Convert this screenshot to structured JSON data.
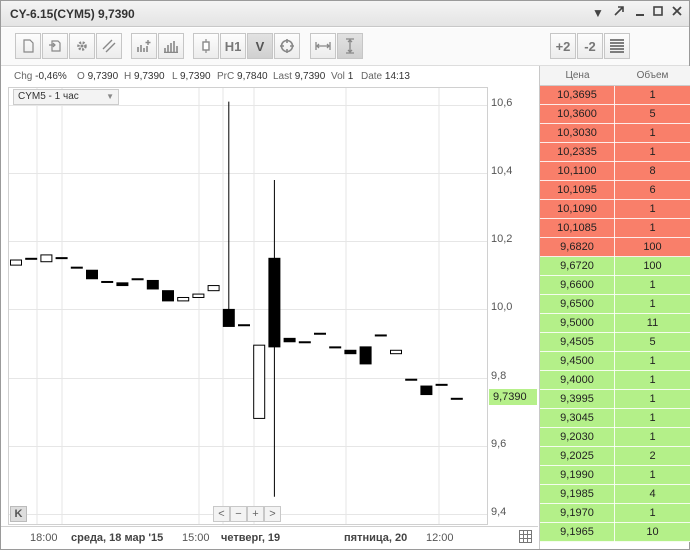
{
  "window": {
    "title": "CY-6.15(CYM5) 9,7390"
  },
  "toolbar": {
    "zoom_plus": "+2",
    "zoom_minus": "-2",
    "interval": "H1",
    "v_label": "V"
  },
  "infobar": {
    "chg_label": "Chg",
    "chg": "-0,46%",
    "o_label": "O",
    "o": "9,7390",
    "h_label": "H",
    "h": "9,7390",
    "l_label": "L",
    "l": "9,7390",
    "prc_label": "PrC",
    "prc": "9,7840",
    "last_label": "Last",
    "last": "9,7390",
    "vol_label": "Vol",
    "vol": "1",
    "date_label": "Date",
    "date": "14:13"
  },
  "chart": {
    "symbol_label": "CYM5 - 1 час",
    "last_price": "9,7390",
    "nav": {
      "left": "<",
      "minus": "−",
      "plus": "+",
      "right": ">"
    },
    "k_button": "K"
  },
  "chart_data": {
    "type": "candlestick",
    "ylim": [
      9.37,
      10.65
    ],
    "yticks": [
      "10,6",
      "10,4",
      "10,2",
      "10,0",
      "9,8",
      "9,6",
      "9,4"
    ],
    "ytick_values": [
      10.6,
      10.4,
      10.2,
      10.0,
      9.8,
      9.6,
      9.4
    ],
    "xlabels": [
      {
        "text": "18:00",
        "bold": false
      },
      {
        "text": "среда, 18 мар '15",
        "bold": true
      },
      {
        "text": "15:00",
        "bold": false
      },
      {
        "text": "четверг, 19",
        "bold": true
      },
      {
        "text": "пятница, 20",
        "bold": true
      },
      {
        "text": "12:00",
        "bold": false
      }
    ],
    "candles": [
      {
        "o": 10.13,
        "c": 10.145,
        "h": 10.145,
        "l": 10.13
      },
      {
        "o": 10.15,
        "c": 10.15,
        "h": 10.15,
        "l": 10.15
      },
      {
        "o": 10.14,
        "c": 10.16,
        "h": 10.16,
        "l": 10.14
      },
      {
        "o": 10.152,
        "c": 10.152,
        "h": 10.152,
        "l": 10.152
      },
      {
        "o": 10.124,
        "c": 10.124,
        "h": 10.124,
        "l": 10.124
      },
      {
        "o": 10.115,
        "c": 10.09,
        "h": 10.115,
        "l": 10.09
      },
      {
        "o": 10.082,
        "c": 10.082,
        "h": 10.082,
        "l": 10.082
      },
      {
        "o": 10.078,
        "c": 10.07,
        "h": 10.078,
        "l": 10.07
      },
      {
        "o": 10.09,
        "c": 10.09,
        "h": 10.09,
        "l": 10.09
      },
      {
        "o": 10.085,
        "c": 10.06,
        "h": 10.085,
        "l": 10.06
      },
      {
        "o": 10.055,
        "c": 10.025,
        "h": 10.055,
        "l": 10.025
      },
      {
        "o": 10.025,
        "c": 10.035,
        "h": 10.035,
        "l": 10.025
      },
      {
        "o": 10.035,
        "c": 10.045,
        "h": 10.045,
        "l": 10.035
      },
      {
        "o": 10.055,
        "c": 10.07,
        "h": 10.07,
        "l": 10.055
      },
      {
        "o": 10.0,
        "c": 9.95,
        "h": 10.61,
        "l": 9.95
      },
      {
        "o": 9.955,
        "c": 9.955,
        "h": 9.955,
        "l": 9.955
      },
      {
        "o": 9.68,
        "c": 9.895,
        "h": 9.895,
        "l": 9.68
      },
      {
        "o": 10.15,
        "c": 9.89,
        "h": 10.38,
        "l": 9.45
      },
      {
        "o": 9.915,
        "c": 9.905,
        "h": 9.915,
        "l": 9.905
      },
      {
        "o": 9.905,
        "c": 9.905,
        "h": 9.905,
        "l": 9.905
      },
      {
        "o": 9.93,
        "c": 9.93,
        "h": 9.93,
        "l": 9.93
      },
      {
        "o": 9.89,
        "c": 9.89,
        "h": 9.89,
        "l": 9.89
      },
      {
        "o": 9.88,
        "c": 9.87,
        "h": 9.88,
        "l": 9.87
      },
      {
        "o": 9.89,
        "c": 9.84,
        "h": 9.89,
        "l": 9.84
      },
      {
        "o": 9.925,
        "c": 9.925,
        "h": 9.925,
        "l": 9.925
      },
      {
        "o": 9.87,
        "c": 9.88,
        "h": 9.88,
        "l": 9.87
      },
      {
        "o": 9.795,
        "c": 9.795,
        "h": 9.795,
        "l": 9.795
      },
      {
        "o": 9.775,
        "c": 9.75,
        "h": 9.775,
        "l": 9.75
      },
      {
        "o": 9.78,
        "c": 9.78,
        "h": 9.78,
        "l": 9.78
      },
      {
        "o": 9.739,
        "c": 9.739,
        "h": 9.739,
        "l": 9.739
      }
    ]
  },
  "orderbook": {
    "col_price": "Цена",
    "col_volume": "Объем",
    "rows": [
      {
        "price": "10,3695",
        "volume": "1",
        "side": "ask"
      },
      {
        "price": "10,3600",
        "volume": "5",
        "side": "ask"
      },
      {
        "price": "10,3030",
        "volume": "1",
        "side": "ask"
      },
      {
        "price": "10,2335",
        "volume": "1",
        "side": "ask"
      },
      {
        "price": "10,1100",
        "volume": "8",
        "side": "ask"
      },
      {
        "price": "10,1095",
        "volume": "6",
        "side": "ask"
      },
      {
        "price": "10,1090",
        "volume": "1",
        "side": "ask"
      },
      {
        "price": "10,1085",
        "volume": "1",
        "side": "ask"
      },
      {
        "price": "9,6820",
        "volume": "100",
        "side": "ask"
      },
      {
        "price": "9,6720",
        "volume": "100",
        "side": "bid"
      },
      {
        "price": "9,6600",
        "volume": "1",
        "side": "bid"
      },
      {
        "price": "9,6500",
        "volume": "1",
        "side": "bid"
      },
      {
        "price": "9,5000",
        "volume": "11",
        "side": "bid"
      },
      {
        "price": "9,4505",
        "volume": "5",
        "side": "bid"
      },
      {
        "price": "9,4500",
        "volume": "1",
        "side": "bid"
      },
      {
        "price": "9,4000",
        "volume": "1",
        "side": "bid"
      },
      {
        "price": "9,3995",
        "volume": "1",
        "side": "bid"
      },
      {
        "price": "9,3045",
        "volume": "1",
        "side": "bid"
      },
      {
        "price": "9,2030",
        "volume": "1",
        "side": "bid"
      },
      {
        "price": "9,2025",
        "volume": "2",
        "side": "bid"
      },
      {
        "price": "9,1990",
        "volume": "1",
        "side": "bid"
      },
      {
        "price": "9,1985",
        "volume": "4",
        "side": "bid"
      },
      {
        "price": "9,1970",
        "volume": "1",
        "side": "bid"
      },
      {
        "price": "9,1965",
        "volume": "10",
        "side": "bid"
      }
    ]
  }
}
